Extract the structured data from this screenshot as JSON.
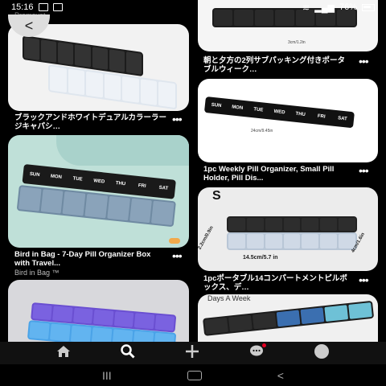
{
  "status": {
    "time": "15:16",
    "battery": "76%"
  },
  "feed": {
    "promo_label": "Promovat",
    "back_symbol": "<",
    "cards": [
      {
        "caption": "ブラックアンドホワイトデュアルカラーラージキャパシ…"
      },
      {
        "caption": "朝と夕方の2列サブパッキング付きポータブルウィーク…"
      },
      {
        "caption": "Bird in Bag - 7-Day Pill Organizer Box with Travel...",
        "sub": "Bird in Bag ™"
      },
      {
        "caption": "1pc Weekly Pill Organizer, Small Pill Holder, Pill Dis..."
      },
      {
        "caption": "1pcポータブル14コンパートメントピルボックス、デ…"
      },
      {
        "caption": ""
      }
    ],
    "image_texts": {
      "size_tag": "S",
      "dim_long": "14.5cm/5.7 in",
      "dim_short": "2.2cm/0.9in",
      "dim_side": "4cm/1.6in",
      "dim_pill": "24cm/9.45in",
      "dim_pill_h": "3cm/1.2in",
      "days_a_week": "Days A Week"
    },
    "days": [
      "SUN",
      "MON",
      "TUE",
      "WED",
      "THU",
      "FRI",
      "SAT"
    ]
  },
  "nav": {
    "items": [
      "home-icon",
      "search-icon",
      "create-icon",
      "messages-icon",
      "profile-icon"
    ]
  },
  "sysnav": {
    "recents": "III",
    "back": "<"
  }
}
